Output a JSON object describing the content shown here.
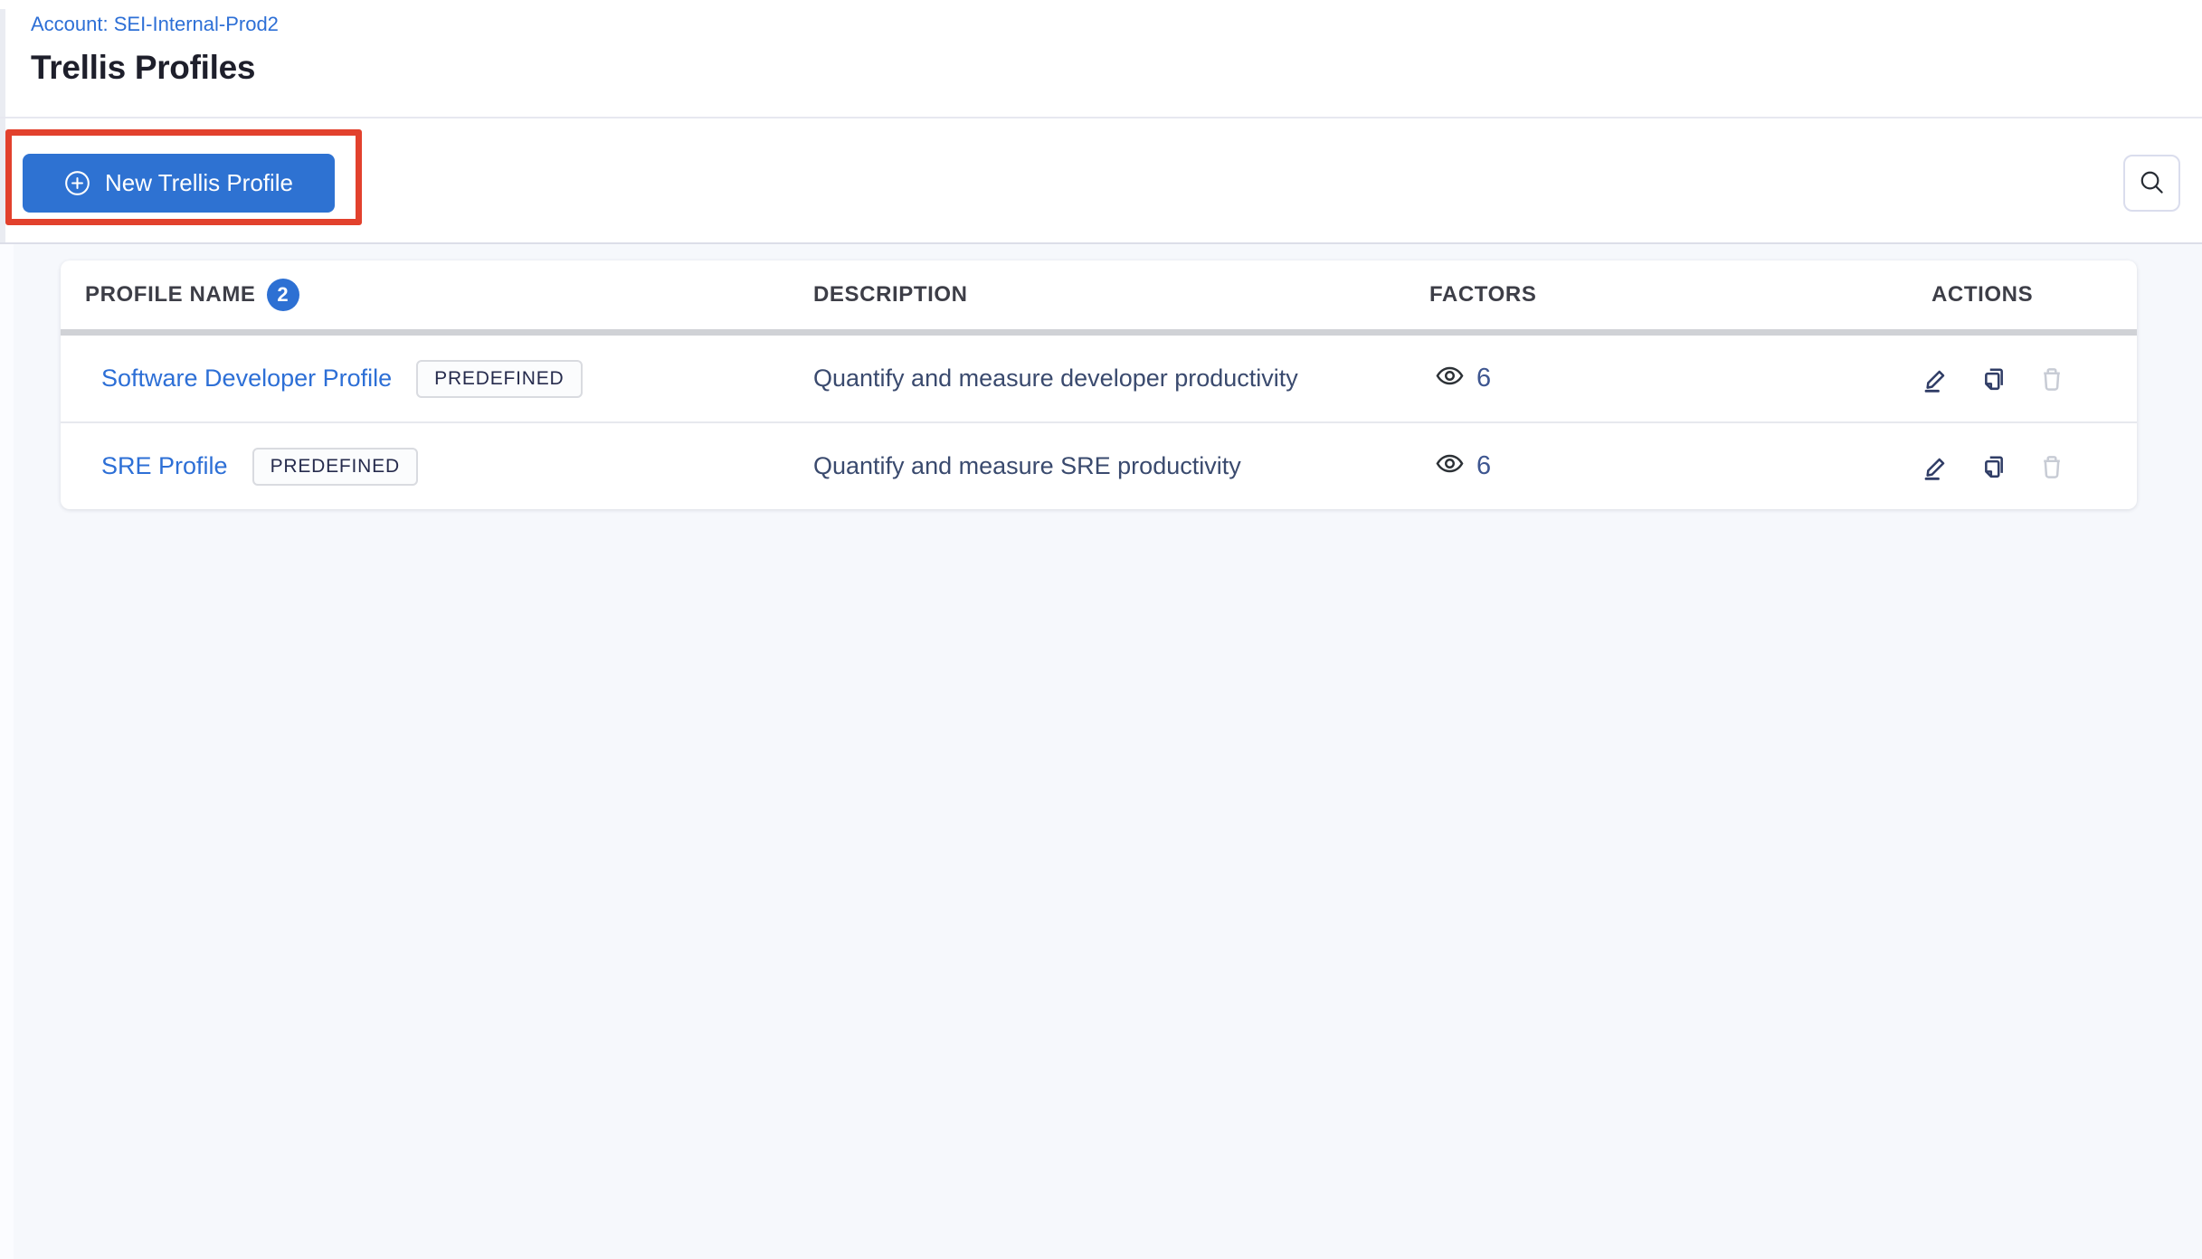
{
  "page": {
    "account_label": "Account: SEI-Internal-Prod2",
    "title": "Trellis Profiles"
  },
  "toolbar": {
    "new_profile_button": "New Trellis Profile",
    "search_icon": "search-icon",
    "new_profile_icon": "plus-circle-icon"
  },
  "annotation": {
    "type": "highlight-box",
    "color": "#e2412d"
  },
  "table": {
    "headers": {
      "profile_name": "PROFILE NAME",
      "profile_count": "2",
      "description": "DESCRIPTION",
      "factors": "FACTORS",
      "actions": "ACTIONS"
    },
    "rows": [
      {
        "name": "Software Developer Profile",
        "tag": "PREDEFINED",
        "description": "Quantify and measure developer productivity",
        "factors_count": "6"
      },
      {
        "name": "SRE Profile",
        "tag": "PREDEFINED",
        "description": "Quantify and measure SRE productivity",
        "factors_count": "6"
      }
    ],
    "icon_names": {
      "factors": "eye-icon",
      "actions": [
        "edit-icon",
        "copy-icon",
        "delete-icon"
      ]
    }
  },
  "colors": {
    "primary_blue": "#2e72d2",
    "link_blue": "#2d6fd6",
    "annotation_red": "#e2412d",
    "title_text": "#1e1f2b",
    "body_navy": "#3a4a6e",
    "factors_navy": "#3e5690",
    "disabled_gray": "#c8ccd5",
    "lower_background": "#f6f8fc"
  }
}
